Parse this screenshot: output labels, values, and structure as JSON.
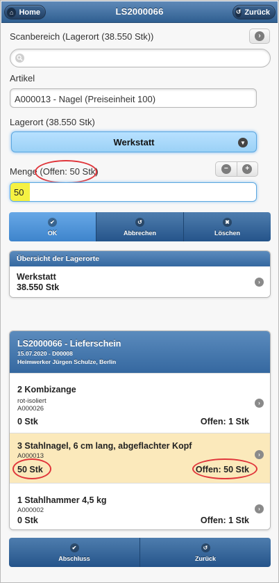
{
  "header": {
    "title": "LS2000066",
    "home_label": "Home",
    "back_label": "Zurück"
  },
  "scan": {
    "label": "Scanbereich (Lagerort (38.550 Stk))",
    "placeholder": ""
  },
  "article": {
    "label": "Artikel",
    "value": "A000013 - Nagel (Preiseinheit 100)"
  },
  "location": {
    "label": "Lagerort (38.550 Stk)",
    "selected": "Werkstatt"
  },
  "quantity": {
    "label": "Menge",
    "open_text": "(Offen: 50 Stk)",
    "value": "50"
  },
  "actions": [
    {
      "label": "OK",
      "icon": "check-icon"
    },
    {
      "label": "Abbrechen",
      "icon": "undo-icon"
    },
    {
      "label": "Löschen",
      "icon": "x-icon"
    }
  ],
  "overview": {
    "title": "Übersicht der Lagerorte",
    "items": [
      {
        "name": "Werkstatt",
        "qty": "38.550 Stk"
      }
    ]
  },
  "delivery": {
    "title": "LS2000066 - Lieferschein",
    "date_line": "15.07.2020 - D00008",
    "customer": "Heimwerker Jürgen Schulze, Berlin",
    "items": [
      {
        "name": "2 Kombizange",
        "detail": "rot-isoliert",
        "code": "A000026",
        "qty": "0 Stk",
        "open": "Offen: 1 Stk",
        "highlight": false
      },
      {
        "name": "3 Stahlnagel, 6 cm lang, abgeflachter Kopf",
        "detail": "",
        "code": "A000013",
        "qty": "50 Stk",
        "open": "Offen: 50 Stk",
        "highlight": true
      },
      {
        "name": "1 Stahlhammer 4,5 kg",
        "detail": "",
        "code": "A000002",
        "qty": "0 Stk",
        "open": "Offen: 1 Stk",
        "highlight": false
      }
    ]
  },
  "footer": [
    {
      "label": "Abschluss",
      "icon": "check-icon"
    },
    {
      "label": "Zurück",
      "icon": "undo-icon"
    }
  ],
  "colors": {
    "header": "#3a6899",
    "accent": "#9bd1f6",
    "highlight_row": "#fbe9bb",
    "annotation": "#e0353a",
    "input_highlight": "#f5f142"
  }
}
